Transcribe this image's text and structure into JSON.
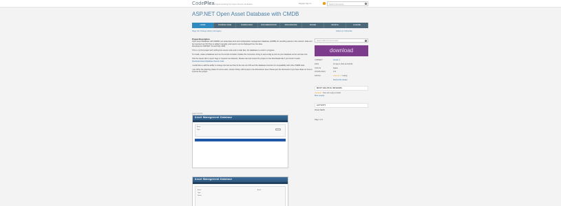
{
  "topbar": {
    "logo_a": "Code",
    "logo_b": "Plex",
    "tagline": "Project Hosting for Open Source Software",
    "links": "Register  Sign in",
    "search_placeholder": "Search all projects"
  },
  "page": {
    "title": "ASP.NET Open Asset Database with CMDB"
  },
  "nav": {
    "tabs": [
      "HOME",
      "SOURCE CODE",
      "DOWNLOADS",
      "DOCUMENTATION",
      "DISCUSSIONS",
      "ISSUES",
      "PEOPLE",
      "LICENSE"
    ]
  },
  "breadcrumb": "Page Info    Change History (all pages)",
  "crumb_right": "Follow (1)    Subscribe",
  "content": {
    "heading": "Project Description",
    "p1": "Open Asset Database with CMDB is an asset data store and configuration management database (CMDB) for recording assets in the network. Data can be imported via CSV files or added manually, and reports can be displayed from the data.",
    "p1b": "Developed in ASP.NET 4.0 and SQL 2008.",
    "p2": "This is my first project with nothing but source code and no help files, the database is a work in progress.",
    "p3": "To install, create a database and run the scripts included. Update the connection string in web.config to point at your database server and site root.",
    "p4": "Visit the Issues tab to report bugs or request new features. Please rate and review the project on the Downloads tab if you found it useful.",
    "p4b": "Download Asset Database Source Code",
    "p5": "I would like to add the ability to change the look and feel of the site via CSS and the database structure for compatibility with other CMDB tools.",
    "p6": "I am still in the planning phase for some parts, version history will be kept in the discussions area. Please join the discussion if you have ideas on how to improve the project.",
    "shot_label": "Asset Console",
    "app_title": "Asset Management Database",
    "form_a": "Asset:",
    "form_b": "Type:",
    "form_c": "Status:"
  },
  "sidebar": {
    "search_placeholder": "Search Wiki & Documentation",
    "download_label": "download",
    "meta": [
      {
        "k": "CURRENT",
        "v": "Version 1"
      },
      {
        "k": "DATE",
        "v": "Fri Sep 9, 2011 at 8:00 AM"
      },
      {
        "k": "STATUS",
        "v": "Stable"
      },
      {
        "k": "DOWNLOADS",
        "v": "172"
      },
      {
        "k": "RATING",
        "v": "1 rating"
      }
    ],
    "rating_stars": "★★★★☆",
    "reviews_link": "Review this release",
    "reviews_head": "MOST HELPFUL REVIEWS",
    "review_stars": "★★★★☆",
    "review_text": "Nice tool, easy to install.",
    "more_link": "More reviews",
    "activity_head": "ACTIVITY",
    "activity_text": "PAGE VIEWS",
    "footer_text": "Page 1 of 1"
  }
}
